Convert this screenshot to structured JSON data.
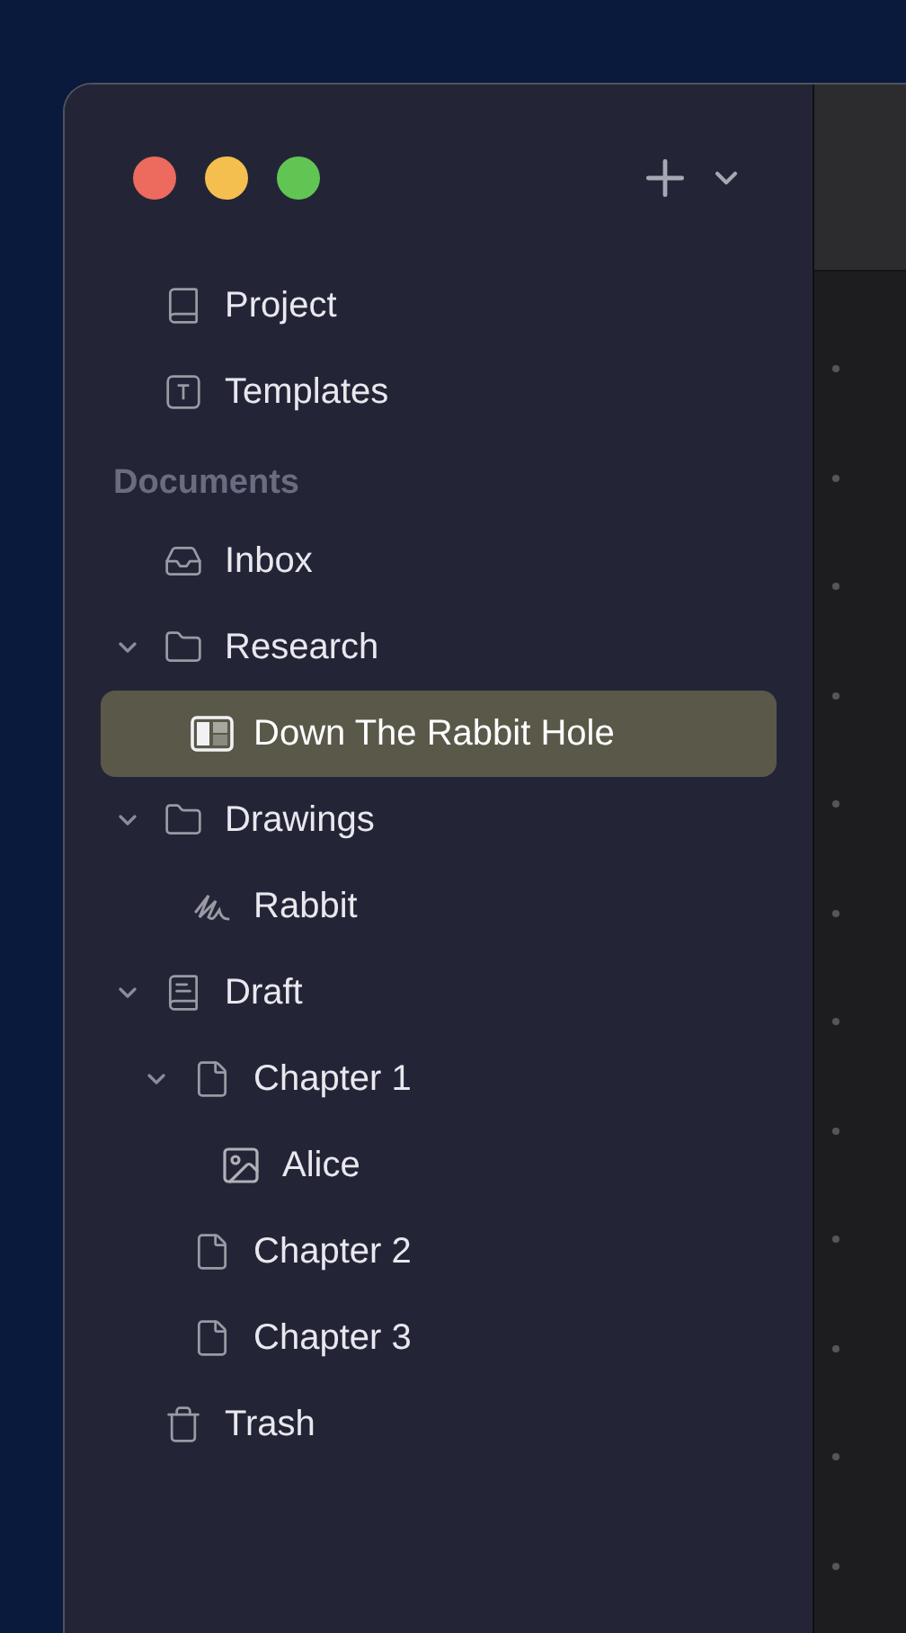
{
  "sidebar": {
    "top_items": [
      {
        "label": "Project",
        "kind": "project",
        "selected": false
      },
      {
        "label": "Templates",
        "kind": "templates",
        "selected": false
      }
    ],
    "section_title": "Documents",
    "tree": [
      {
        "label": "Inbox",
        "kind": "inbox",
        "selected": false
      },
      {
        "label": "Research",
        "kind": "folder",
        "selected": false,
        "expanded": true,
        "children": [
          {
            "label": "Down The Rabbit Hole",
            "kind": "split-document",
            "selected": true
          }
        ]
      },
      {
        "label": "Drawings",
        "kind": "folder",
        "selected": false,
        "expanded": true,
        "children": [
          {
            "label": "Rabbit",
            "kind": "sketch",
            "selected": false
          }
        ]
      },
      {
        "label": "Draft",
        "kind": "draft",
        "selected": false,
        "expanded": true,
        "children": [
          {
            "label": "Chapter 1",
            "kind": "file",
            "selected": false,
            "expanded": true,
            "children": [
              {
                "label": "Alice",
                "kind": "image",
                "selected": false
              }
            ]
          },
          {
            "label": "Chapter 2",
            "kind": "file",
            "selected": false
          },
          {
            "label": "Chapter 3",
            "kind": "file",
            "selected": false
          }
        ]
      },
      {
        "label": "Trash",
        "kind": "trash",
        "selected": false
      }
    ]
  }
}
